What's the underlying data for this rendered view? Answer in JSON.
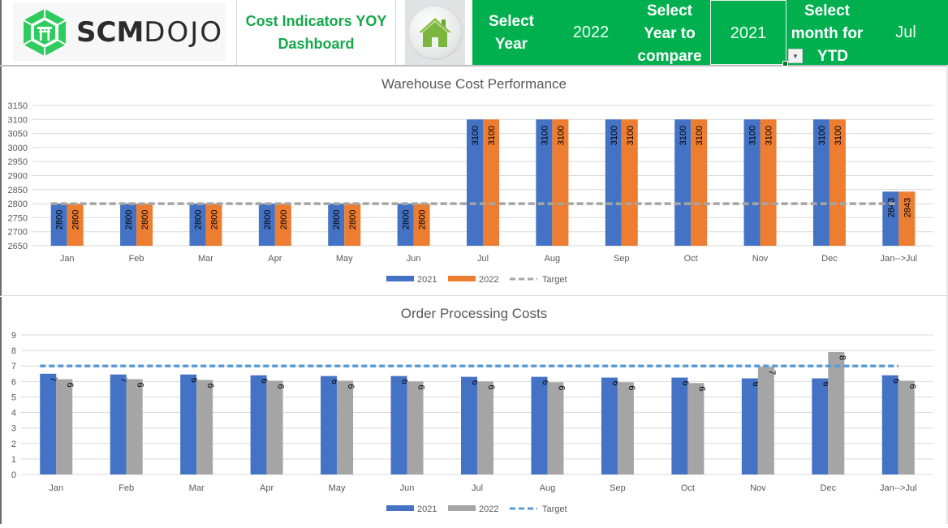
{
  "header": {
    "logo": {
      "bold": "SCM",
      "light": "DOJO"
    },
    "title_line1": "Cost Indicators  YOY",
    "title_line2": "Dashboard",
    "home_button": "home-icon",
    "select_year_label_line1": "Select",
    "select_year_label_line2": "Year",
    "select_year_value": "2022",
    "compare_label_line1": "Select",
    "compare_label_line2": "Year to",
    "compare_label_line3": "compare",
    "compare_value": "2021",
    "ytd_label_line1": "Select",
    "ytd_label_line2": "month for",
    "ytd_label_line3": "YTD",
    "ytd_value": "Jul",
    "colors": {
      "green": "#00b04f",
      "title_green": "#14a84a"
    }
  },
  "chart_data": [
    {
      "type": "bar",
      "title": "Warehouse Cost Performance",
      "categories": [
        "Jan",
        "Feb",
        "Mar",
        "Apr",
        "May",
        "Jun",
        "Jul",
        "Aug",
        "Sep",
        "Oct",
        "Nov",
        "Dec",
        "Jan-->Jul"
      ],
      "series": [
        {
          "name": "2021",
          "color": "#4472c4",
          "values": [
            2800,
            2800,
            2800,
            2800,
            2800,
            2800,
            3100,
            3100,
            3100,
            3100,
            3100,
            3100,
            2843
          ]
        },
        {
          "name": "2022",
          "color": "#ed7d31",
          "values": [
            2800,
            2800,
            2800,
            2800,
            2800,
            2800,
            3100,
            3100,
            3100,
            3100,
            3100,
            3100,
            2843
          ]
        }
      ],
      "target": {
        "name": "Target",
        "color": "#a5a5a5",
        "value": 2800
      },
      "ylim": [
        2650,
        3150
      ],
      "yticks": [
        2650,
        2700,
        2750,
        2800,
        2850,
        2900,
        2950,
        3000,
        3050,
        3100,
        3150
      ],
      "xlabel": "",
      "ylabel": "",
      "grid": true,
      "legend": "bottom"
    },
    {
      "type": "bar",
      "title": "Order Processing Costs",
      "categories": [
        "Jan",
        "Feb",
        "Mar",
        "Apr",
        "May",
        "Jun",
        "Jul",
        "Aug",
        "Sep",
        "Oct",
        "Nov",
        "Dec",
        "Jan-->Jul"
      ],
      "series": [
        {
          "name": "2021",
          "color": "#4472c4",
          "values": [
            6.5,
            6.45,
            6.45,
            6.4,
            6.35,
            6.35,
            6.3,
            6.3,
            6.25,
            6.25,
            6.2,
            6.2,
            6.4
          ],
          "labels": [
            "7",
            "7",
            "6",
            "6",
            "6",
            "6",
            "6",
            "6",
            "6",
            "6",
            "6",
            "6",
            "6"
          ]
        },
        {
          "name": "2022",
          "color": "#a5a5a5",
          "values": [
            6.15,
            6.15,
            6.1,
            6.05,
            6.05,
            6.0,
            6.0,
            5.95,
            5.95,
            5.9,
            6.95,
            7.9,
            6.05
          ],
          "labels": [
            "6",
            "6",
            "6",
            "6",
            "6",
            "6",
            "6",
            "6",
            "6",
            "6",
            "7",
            "8",
            "6"
          ]
        }
      ],
      "target": {
        "name": "Target",
        "color": "#5b9bd5",
        "value": 7
      },
      "ylim": [
        0,
        9
      ],
      "yticks": [
        0,
        1,
        2,
        3,
        4,
        5,
        6,
        7,
        8,
        9
      ],
      "xlabel": "",
      "ylabel": "",
      "grid": true,
      "legend": "bottom"
    }
  ]
}
